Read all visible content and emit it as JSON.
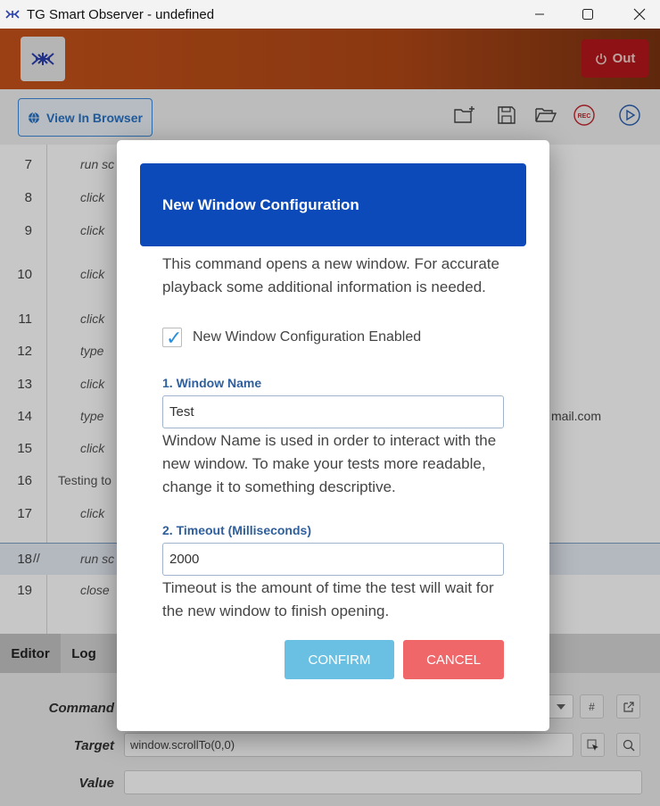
{
  "window": {
    "title": "TG Smart Observer - undefined"
  },
  "header": {
    "out_label": "Out"
  },
  "toolbar": {
    "view_in_browser_label": "View In Browser",
    "icons": [
      "new-folder-icon",
      "save-icon",
      "open-folder-icon",
      "record-icon",
      "play-icon"
    ],
    "record_badge": "REC"
  },
  "code_lines": [
    {
      "num": "7",
      "comment": "",
      "command": "run sc",
      "tail": ""
    },
    {
      "num": "8",
      "comment": "",
      "command": "click",
      "tail": ""
    },
    {
      "num": "9",
      "comment": "",
      "command": "click",
      "tail": ""
    },
    {
      "num": "10",
      "comment": "",
      "command": "click",
      "tail": ""
    },
    {
      "num": "11",
      "comment": "",
      "command": "click",
      "tail": ""
    },
    {
      "num": "12",
      "comment": "",
      "command": "type",
      "tail": ""
    },
    {
      "num": "13",
      "comment": "",
      "command": "click",
      "tail": ""
    },
    {
      "num": "14",
      "comment": "",
      "command": "type",
      "tail": "mail.com"
    },
    {
      "num": "15",
      "comment": "",
      "command": "click",
      "tail": ""
    },
    {
      "num": "16",
      "comment": "",
      "command": "Testing to",
      "tail": ""
    },
    {
      "num": "17",
      "comment": "",
      "command": "click",
      "tail": ""
    },
    {
      "num": "18",
      "comment": "//",
      "command": "run sc",
      "tail": ""
    },
    {
      "num": "19",
      "comment": "",
      "command": "close",
      "tail": ""
    }
  ],
  "tabs": {
    "editor": "Editor",
    "log": "Log"
  },
  "editor": {
    "command_label": "Command",
    "target_label": "Target",
    "target_value": "window.scrollTo(0,0)",
    "value_label": "Value",
    "hash_button": "#"
  },
  "modal": {
    "title": "New Window Configuration",
    "intro": "This command opens a new window. For accurate playback some additional information is needed.",
    "checkbox_label": "New Window Configuration Enabled",
    "checkbox_checked": true,
    "window_name_label": "1. Window Name",
    "window_name_value": "Test",
    "window_name_help": "Window Name is used in order to interact with the new window. To make your tests more readable, change it to something descriptive.",
    "timeout_label": "2. Timeout (Milliseconds)",
    "timeout_value": "2000",
    "timeout_help": "Timeout is the amount of time the test will wait for the new window to finish opening.",
    "confirm_label": "CONFIRM",
    "cancel_label": "CANCEL"
  },
  "colors": {
    "header_orange": "#c7531a",
    "out_button": "#b5161b",
    "modal_header": "#0b4ab8",
    "confirm": "#6ac0e3",
    "cancel": "#f0676a"
  }
}
